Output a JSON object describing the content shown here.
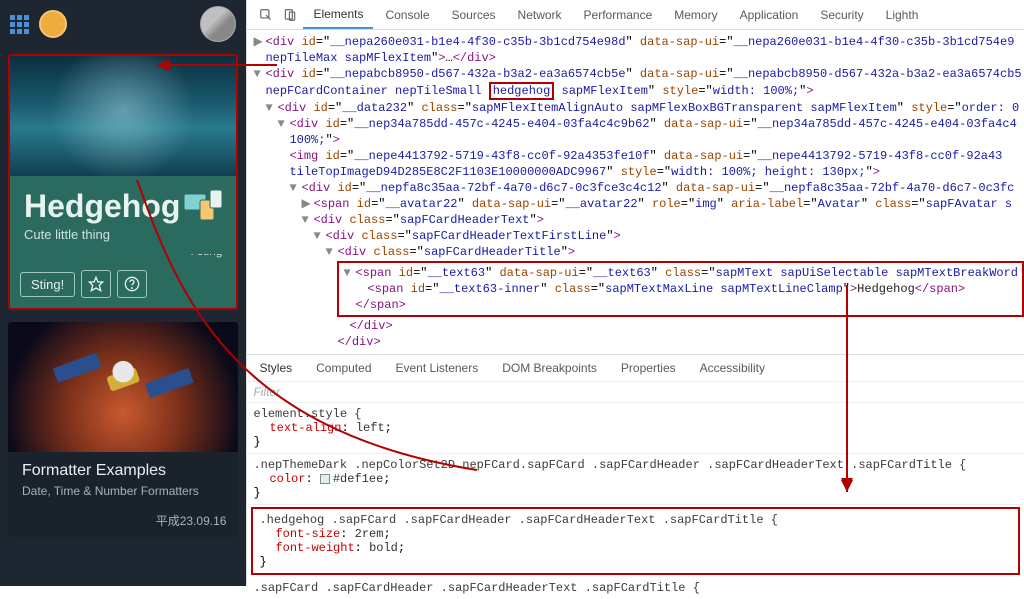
{
  "topbar": {
    "avatar_initial": "·"
  },
  "devtools": {
    "tabs": [
      "Elements",
      "Console",
      "Sources",
      "Network",
      "Performance",
      "Memory",
      "Application",
      "Security",
      "Lighth"
    ],
    "active_tab": "Elements",
    "styles_tabs": [
      "Styles",
      "Computed",
      "Event Listeners",
      "DOM Breakpoints",
      "Properties",
      "Accessibility"
    ],
    "styles_active": "Styles",
    "filter_placeholder": "Filter"
  },
  "card1": {
    "title": "Hedgehog",
    "subtitle": "Cute little thing",
    "corner_text": "I sting",
    "button_label": "Sting!"
  },
  "card2": {
    "title": "Formatter Examples",
    "subtitle": "Date, Time & Number Formatters",
    "date": "平成23.09.16"
  },
  "dom": {
    "l1": {
      "tag": "div",
      "id": "__nepa260e031-b1e4-4f30-c35b-3b1cd754e98d",
      "data_sap_ui": "__nepa260e031-b1e4-4f30-c35b-3b1cd754e9",
      "class_fragment": "nepTileMax sapMFlexItem",
      "trail": "…",
      "close": "</div>"
    },
    "l2": {
      "tag": "div",
      "id": "__nepabcb8950-d567-432a-b3a2-ea3a6574cb5e",
      "data_sap_ui": "__nepabcb8950-d567-432a-b3a2-ea3a6574cb5",
      "class_pre": "nepFCardContainer nepTileSmall",
      "class_hi": "hedgehog",
      "class_post": "sapMFlexItem",
      "style": "width: 100%;"
    },
    "l3": {
      "tag": "div",
      "id": "__data232",
      "cls": "sapMFlexItemAlignAuto sapMFlexBoxBGTransparent sapMFlexItem",
      "style": "order: 0"
    },
    "l4": {
      "tag": "div",
      "id": "__nep34a785dd-457c-4245-e404-03fa4c4c9b62",
      "data_sap_ui": "__nep34a785dd-457c-4245-e404-03fa4c4",
      "pct": "100%;"
    },
    "l5": {
      "tag": "img",
      "id": "__nepe4413792-5719-43f8-cc0f-92a4353fe10f",
      "data_sap_ui": "__nepe4413792-5719-43f8-cc0f-92a43",
      "cls": "tileTopImageD94D285E8C2F1103E10000000ADC9967",
      "style": "width: 100%; height: 130px;"
    },
    "l6": {
      "tag": "div",
      "id": "__nepfa8c35aa-72bf-4a70-d6c7-0c3fce3c4c12",
      "data_sap_ui": "__nepfa8c35aa-72bf-4a70-d6c7-0c3fc"
    },
    "l7": {
      "tag": "span",
      "id": "__avatar22",
      "data_sap_ui": "__avatar22",
      "role": "img",
      "aria": "Avatar",
      "cls": "sapFAvatar s"
    },
    "l8": {
      "tag": "div",
      "cls": "sapFCardHeaderText"
    },
    "l9": {
      "tag": "div",
      "cls": "sapFCardHeaderTextFirstLine"
    },
    "l10": {
      "tag": "div",
      "cls": "sapFCardHeaderTitle"
    },
    "l11": {
      "tag": "span",
      "id": "__text63",
      "data_sap_ui": "__text63",
      "cls": "sapMText sapUiSelectable sapMTextBreakWord"
    },
    "l12": {
      "tag": "span",
      "id": "__text63-inner",
      "cls": "sapMTextMaxLine sapMTextLineClamp",
      "text": "Hedgehog",
      "close": "</span>"
    },
    "l13": {
      "close": "</span>"
    },
    "l14": {
      "close": "</div>"
    },
    "l15": {
      "close": "</div>"
    }
  },
  "styles": {
    "r1": {
      "selector": "element.style {",
      "prop": "text-align",
      "val": "left",
      "close": "}"
    },
    "r2": {
      "selector": ".nepThemeDark .nepColorSet2D.nepFCard.sapFCard .sapFCardHeader .sapFCardHeaderText .sapFCardTitle {",
      "prop": "color",
      "val": "#def1ee",
      "close": "}"
    },
    "r3": {
      "selector": ".hedgehog .sapFCard .sapFCardHeader .sapFCardHeaderText .sapFCardTitle {",
      "prop1": "font-size",
      "val1": "2rem",
      "prop2": "font-weight",
      "val2": "bold",
      "close": "}"
    },
    "r4": {
      "selector": ".sapFCard .sapFCardHeader .sapFCardHeaderText .sapFCardTitle {"
    }
  }
}
